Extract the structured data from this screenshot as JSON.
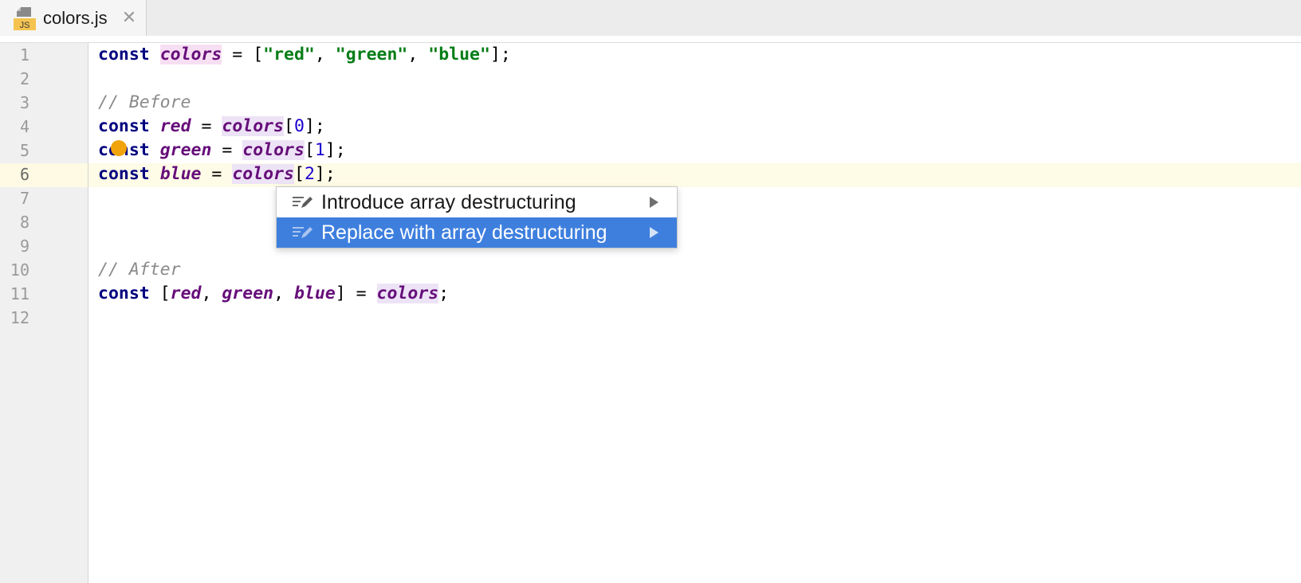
{
  "tab": {
    "filename": "colors.js",
    "file_badge": "JS",
    "close_glyph": "✕"
  },
  "gutter": {
    "line_numbers": [
      "1",
      "2",
      "3",
      "4",
      "5",
      "6",
      "7",
      "8",
      "9",
      "10",
      "11",
      "12"
    ],
    "current_line": "6"
  },
  "code": {
    "line1": {
      "kw": "const",
      "var": "colors",
      "eq": " = [",
      "s1": "\"red\"",
      "c1": ", ",
      "s2": "\"green\"",
      "c2": ", ",
      "s3": "\"blue\"",
      "end": "];"
    },
    "line3": {
      "comment": "// Before"
    },
    "line4": {
      "kw": "const",
      "var": "red",
      "eq": " = ",
      "ref": "colors",
      "open": "[",
      "idx": "0",
      "close": "];"
    },
    "line5": {
      "kw": "const",
      "var": "green",
      "eq": " = ",
      "ref": "colors",
      "open": "[",
      "idx": "1",
      "close": "];"
    },
    "line6": {
      "kw": "const",
      "var": "blue",
      "eq": " = ",
      "ref": "colors",
      "open": "[",
      "idx": "2",
      "close": "];"
    },
    "line10": {
      "comment": "// After"
    },
    "line11": {
      "kw": "const",
      "open": " [",
      "v1": "red",
      "c1": ", ",
      "v2": "green",
      "c2": ", ",
      "v3": "blue",
      "close": "] = ",
      "ref": "colors",
      "end": ";"
    }
  },
  "intention_popup": {
    "items": [
      {
        "label": "Introduce array destructuring",
        "icon": "edit-icon",
        "selected": false
      },
      {
        "label": "Replace with array destructuring",
        "icon": "edit-icon",
        "selected": true
      }
    ]
  },
  "colors": {
    "selection": "#3e7fde",
    "keyword": "#00007f",
    "variable": "#660e7a",
    "string": "#067d17",
    "number": "#1c00cf",
    "comment": "#8a8a8a",
    "intention_bulb": "#f0a30a"
  }
}
